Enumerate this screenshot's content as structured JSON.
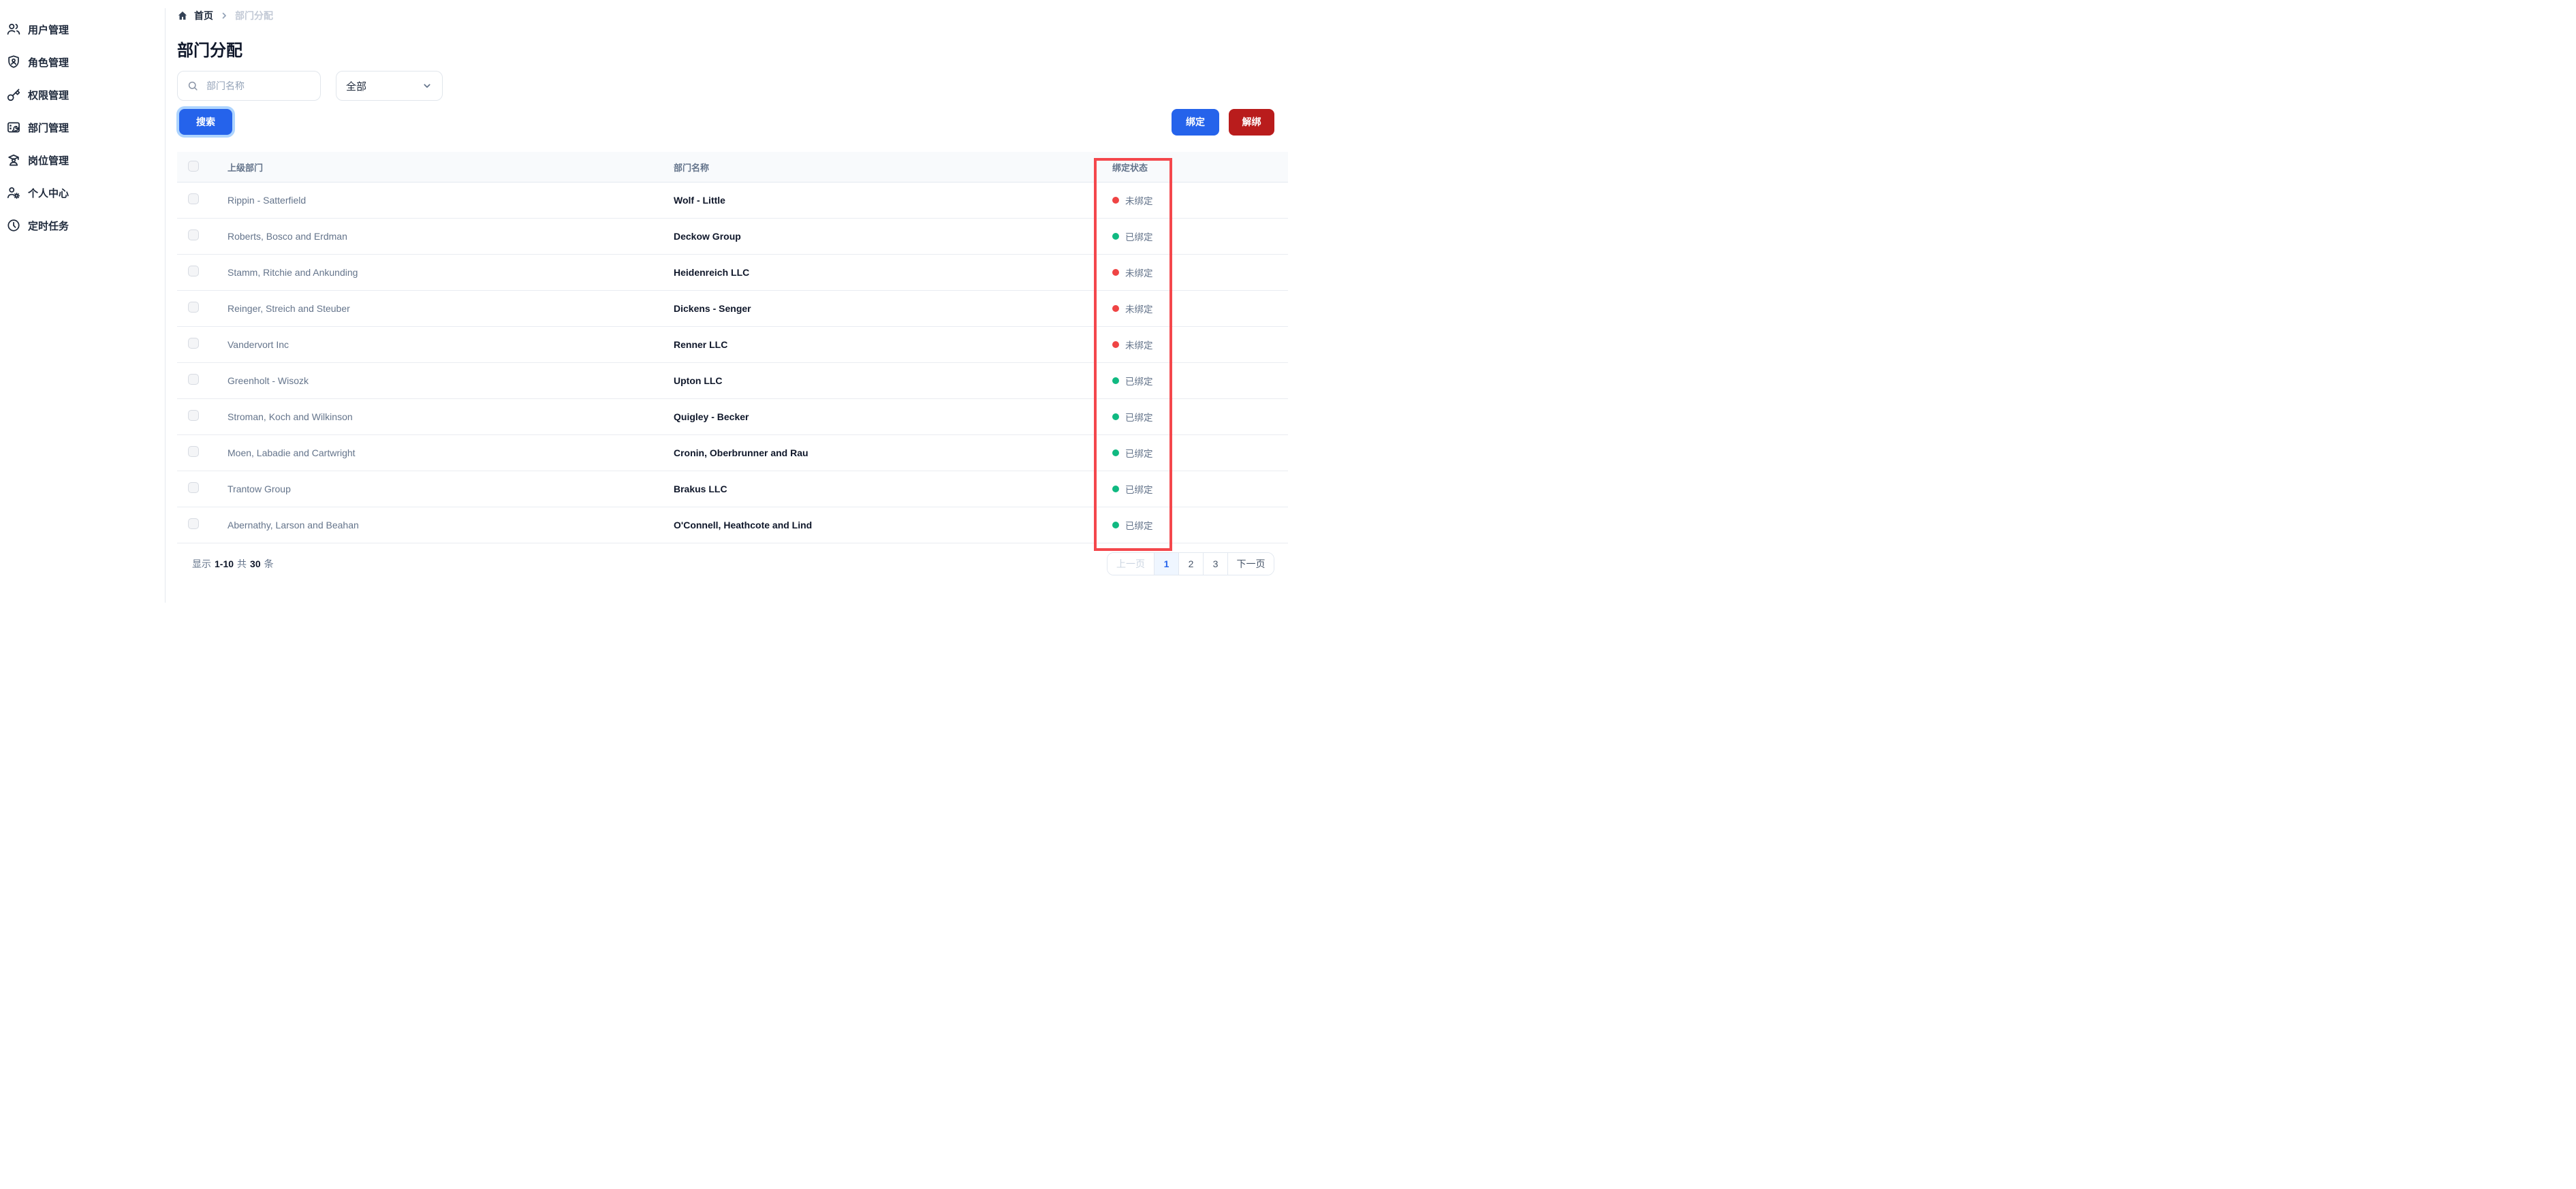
{
  "sidebar": {
    "items": [
      {
        "label": "用户管理",
        "icon": "users-icon"
      },
      {
        "label": "角色管理",
        "icon": "shield-user-icon"
      },
      {
        "label": "权限管理",
        "icon": "key-icon"
      },
      {
        "label": "部门管理",
        "icon": "department-icon"
      },
      {
        "label": "岗位管理",
        "icon": "graduate-icon"
      },
      {
        "label": "个人中心",
        "icon": "user-gear-icon"
      },
      {
        "label": "定时任务",
        "icon": "clock-icon"
      }
    ]
  },
  "breadcrumb": {
    "home": "首页",
    "current": "部门分配"
  },
  "page": {
    "title": "部门分配"
  },
  "toolbar": {
    "search_placeholder": "部门名称",
    "filter_value": "全部",
    "search_label": "搜索",
    "bind_label": "绑定",
    "unbind_label": "解绑"
  },
  "table": {
    "headers": [
      "上级部门",
      "部门名称",
      "绑定状态"
    ],
    "rows": [
      {
        "parent": "Rippin - Satterfield",
        "name": "Wolf - Little",
        "bound": false
      },
      {
        "parent": "Roberts, Bosco and Erdman",
        "name": "Deckow Group",
        "bound": true
      },
      {
        "parent": "Stamm, Ritchie and Ankunding",
        "name": "Heidenreich LLC",
        "bound": false
      },
      {
        "parent": "Reinger, Streich and Steuber",
        "name": "Dickens - Senger",
        "bound": false
      },
      {
        "parent": "Vandervort Inc",
        "name": "Renner LLC",
        "bound": false
      },
      {
        "parent": "Greenholt - Wisozk",
        "name": "Upton LLC",
        "bound": true
      },
      {
        "parent": "Stroman, Koch and Wilkinson",
        "name": "Quigley - Becker",
        "bound": true
      },
      {
        "parent": "Moen, Labadie and Cartwright",
        "name": "Cronin, Oberbrunner and Rau",
        "bound": true
      },
      {
        "parent": "Trantow Group",
        "name": "Brakus LLC",
        "bound": true
      },
      {
        "parent": "Abernathy, Larson and Beahan",
        "name": "O'Connell, Heathcote and Lind",
        "bound": true
      }
    ]
  },
  "status_labels": {
    "bound": "已绑定",
    "unbound": "未绑定"
  },
  "footer": {
    "show_label": "显示",
    "range": "1-10",
    "total_label": "共",
    "total": "30",
    "unit_label": "条",
    "prev": "上一页",
    "pages": [
      "1",
      "2",
      "3"
    ],
    "active_page": "1",
    "next": "下一页"
  },
  "colors": {
    "primary": "#2563eb",
    "danger": "#b91c1c",
    "bound_dot": "#10b981",
    "unbound_dot": "#ef4444",
    "highlight_border": "#f4474c"
  }
}
